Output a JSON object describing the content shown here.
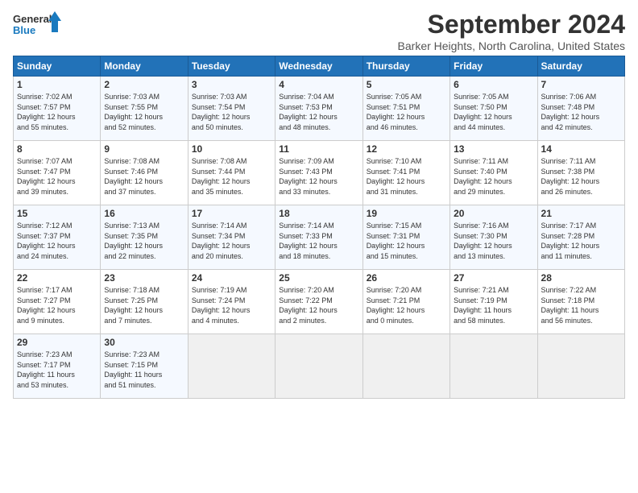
{
  "logo": {
    "line1": "General",
    "line2": "Blue"
  },
  "title": "September 2024",
  "location": "Barker Heights, North Carolina, United States",
  "days_of_week": [
    "Sunday",
    "Monday",
    "Tuesday",
    "Wednesday",
    "Thursday",
    "Friday",
    "Saturday"
  ],
  "weeks": [
    [
      {
        "day": "1",
        "text": "Sunrise: 7:02 AM\nSunset: 7:57 PM\nDaylight: 12 hours\nand 55 minutes."
      },
      {
        "day": "2",
        "text": "Sunrise: 7:03 AM\nSunset: 7:55 PM\nDaylight: 12 hours\nand 52 minutes."
      },
      {
        "day": "3",
        "text": "Sunrise: 7:03 AM\nSunset: 7:54 PM\nDaylight: 12 hours\nand 50 minutes."
      },
      {
        "day": "4",
        "text": "Sunrise: 7:04 AM\nSunset: 7:53 PM\nDaylight: 12 hours\nand 48 minutes."
      },
      {
        "day": "5",
        "text": "Sunrise: 7:05 AM\nSunset: 7:51 PM\nDaylight: 12 hours\nand 46 minutes."
      },
      {
        "day": "6",
        "text": "Sunrise: 7:05 AM\nSunset: 7:50 PM\nDaylight: 12 hours\nand 44 minutes."
      },
      {
        "day": "7",
        "text": "Sunrise: 7:06 AM\nSunset: 7:48 PM\nDaylight: 12 hours\nand 42 minutes."
      }
    ],
    [
      {
        "day": "8",
        "text": "Sunrise: 7:07 AM\nSunset: 7:47 PM\nDaylight: 12 hours\nand 39 minutes."
      },
      {
        "day": "9",
        "text": "Sunrise: 7:08 AM\nSunset: 7:46 PM\nDaylight: 12 hours\nand 37 minutes."
      },
      {
        "day": "10",
        "text": "Sunrise: 7:08 AM\nSunset: 7:44 PM\nDaylight: 12 hours\nand 35 minutes."
      },
      {
        "day": "11",
        "text": "Sunrise: 7:09 AM\nSunset: 7:43 PM\nDaylight: 12 hours\nand 33 minutes."
      },
      {
        "day": "12",
        "text": "Sunrise: 7:10 AM\nSunset: 7:41 PM\nDaylight: 12 hours\nand 31 minutes."
      },
      {
        "day": "13",
        "text": "Sunrise: 7:11 AM\nSunset: 7:40 PM\nDaylight: 12 hours\nand 29 minutes."
      },
      {
        "day": "14",
        "text": "Sunrise: 7:11 AM\nSunset: 7:38 PM\nDaylight: 12 hours\nand 26 minutes."
      }
    ],
    [
      {
        "day": "15",
        "text": "Sunrise: 7:12 AM\nSunset: 7:37 PM\nDaylight: 12 hours\nand 24 minutes."
      },
      {
        "day": "16",
        "text": "Sunrise: 7:13 AM\nSunset: 7:35 PM\nDaylight: 12 hours\nand 22 minutes."
      },
      {
        "day": "17",
        "text": "Sunrise: 7:14 AM\nSunset: 7:34 PM\nDaylight: 12 hours\nand 20 minutes."
      },
      {
        "day": "18",
        "text": "Sunrise: 7:14 AM\nSunset: 7:33 PM\nDaylight: 12 hours\nand 18 minutes."
      },
      {
        "day": "19",
        "text": "Sunrise: 7:15 AM\nSunset: 7:31 PM\nDaylight: 12 hours\nand 15 minutes."
      },
      {
        "day": "20",
        "text": "Sunrise: 7:16 AM\nSunset: 7:30 PM\nDaylight: 12 hours\nand 13 minutes."
      },
      {
        "day": "21",
        "text": "Sunrise: 7:17 AM\nSunset: 7:28 PM\nDaylight: 12 hours\nand 11 minutes."
      }
    ],
    [
      {
        "day": "22",
        "text": "Sunrise: 7:17 AM\nSunset: 7:27 PM\nDaylight: 12 hours\nand 9 minutes."
      },
      {
        "day": "23",
        "text": "Sunrise: 7:18 AM\nSunset: 7:25 PM\nDaylight: 12 hours\nand 7 minutes."
      },
      {
        "day": "24",
        "text": "Sunrise: 7:19 AM\nSunset: 7:24 PM\nDaylight: 12 hours\nand 4 minutes."
      },
      {
        "day": "25",
        "text": "Sunrise: 7:20 AM\nSunset: 7:22 PM\nDaylight: 12 hours\nand 2 minutes."
      },
      {
        "day": "26",
        "text": "Sunrise: 7:20 AM\nSunset: 7:21 PM\nDaylight: 12 hours\nand 0 minutes."
      },
      {
        "day": "27",
        "text": "Sunrise: 7:21 AM\nSunset: 7:19 PM\nDaylight: 11 hours\nand 58 minutes."
      },
      {
        "day": "28",
        "text": "Sunrise: 7:22 AM\nSunset: 7:18 PM\nDaylight: 11 hours\nand 56 minutes."
      }
    ],
    [
      {
        "day": "29",
        "text": "Sunrise: 7:23 AM\nSunset: 7:17 PM\nDaylight: 11 hours\nand 53 minutes."
      },
      {
        "day": "30",
        "text": "Sunrise: 7:23 AM\nSunset: 7:15 PM\nDaylight: 11 hours\nand 51 minutes."
      },
      null,
      null,
      null,
      null,
      null
    ]
  ]
}
